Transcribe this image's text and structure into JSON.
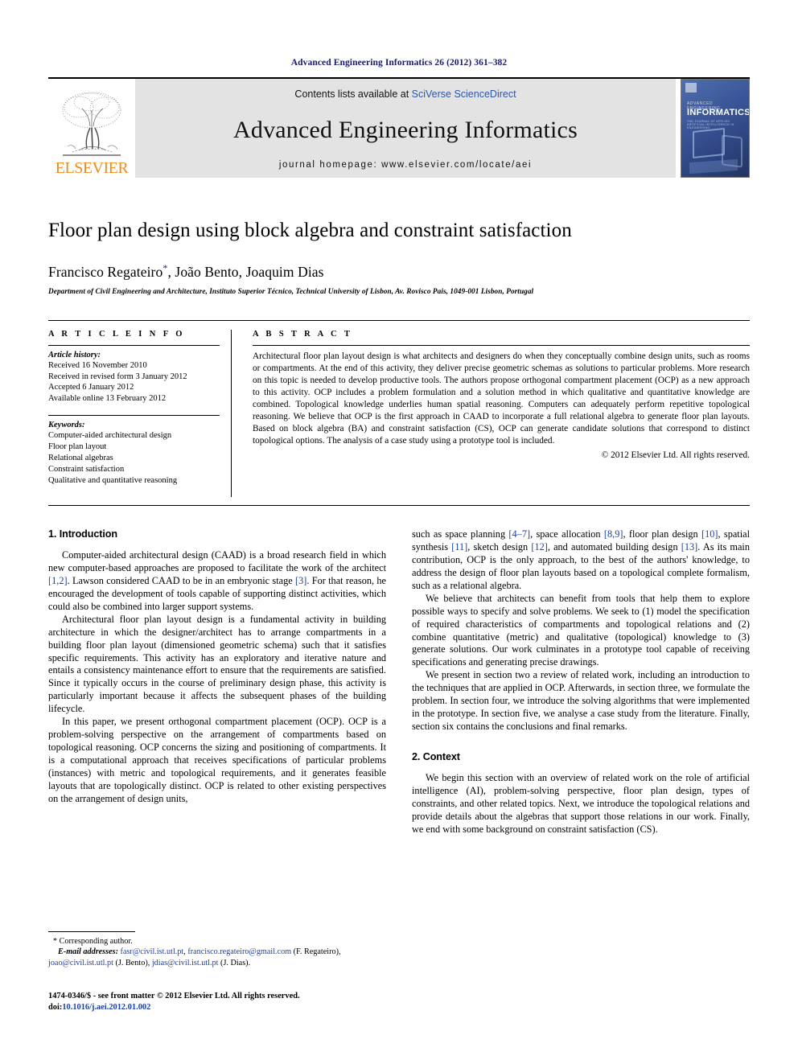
{
  "running_head": "Advanced Engineering Informatics 26 (2012) 361–382",
  "masthead": {
    "publisher_name": "ELSEVIER",
    "contents_prefix": "Contents lists available at ",
    "contents_link": "SciVerse ScienceDirect",
    "journal_title": "Advanced Engineering Informatics",
    "homepage_line": "journal homepage: www.elsevier.com/locate/aei",
    "cover": {
      "supertitle": "ADVANCED ENGINEERING",
      "title": "INFORMATICS",
      "subtitle": "THE JOURNAL OF APPLIED ARTIFICIAL INTELLIGENCE IN ENGINEERING"
    }
  },
  "article": {
    "title": "Floor plan design using block algebra and constraint satisfaction",
    "authors": "Francisco Regateiro",
    "corresponding_marker": "*",
    "authors_rest": ", João Bento, Joaquim Dias",
    "affiliation": "Department of Civil Engineering and Architecture, Instituto Superior Técnico, Technical University of Lisbon, Av. Rovisco Pais, 1049-001 Lisbon, Portugal"
  },
  "article_info": {
    "heading": "A R T I C L E   I N F O",
    "history_label": "Article history:",
    "history": [
      "Received 16 November 2010",
      "Received in revised form 3 January 2012",
      "Accepted 6 January 2012",
      "Available online 13 February 2012"
    ],
    "keywords_label": "Keywords:",
    "keywords": [
      "Computer-aided architectural design",
      "Floor plan layout",
      "Relational algebras",
      "Constraint satisfaction",
      "Qualitative and quantitative reasoning"
    ]
  },
  "abstract": {
    "heading": "A B S T R A C T",
    "text": "Architectural floor plan layout design is what architects and designers do when they conceptually combine design units, such as rooms or compartments. At the end of this activity, they deliver precise geometric schemas as solutions to particular problems. More research on this topic is needed to develop productive tools. The authors propose orthogonal compartment placement (OCP) as a new approach to this activity. OCP includes a problem formulation and a solution method in which qualitative and quantitative knowledge are combined. Topological knowledge underlies human spatial reasoning. Computers can adequately perform repetitive topological reasoning. We believe that OCP is the first approach in CAAD to incorporate a full relational algebra to generate floor plan layouts. Based on block algebra (BA) and constraint satisfaction (CS), OCP can generate candidate solutions that correspond to distinct topological options. The analysis of a case study using a prototype tool is included.",
    "copyright": "© 2012 Elsevier Ltd. All rights reserved."
  },
  "sections": {
    "introduction_heading": "1. Introduction",
    "context_heading": "2. Context"
  },
  "left_column": {
    "p1_a": "Computer-aided architectural design (CAAD) is a broad research field in which new computer-based approaches are proposed to facilitate the work of the architect ",
    "p1_ref1": "[1,2]",
    "p1_b": ". Lawson considered CAAD to be in an embryonic stage ",
    "p1_ref2": "[3]",
    "p1_c": ". For that reason, he encouraged the development of tools capable of supporting distinct activities, which could also be combined into larger support systems.",
    "p2": "Architectural floor plan layout design is a fundamental activity in building architecture in which the designer/architect has to arrange compartments in a building floor plan layout (dimensioned geometric schema) such that it satisfies specific requirements. This activity has an exploratory and iterative nature and entails a consistency maintenance effort to ensure that the requirements are satisfied. Since it typically occurs in the course of preliminary design phase, this activity is particularly important because it affects the subsequent phases of the building lifecycle.",
    "p3": "In this paper, we present orthogonal compartment placement (OCP). OCP is a problem-solving perspective on the arrangement of compartments based on topological reasoning. OCP concerns the sizing and positioning of compartments. It is a computational approach that receives specifications of particular problems (instances) with metric and topological requirements, and it generates feasible layouts that are topologically distinct. OCP is related to other existing perspectives on the arrangement of design units,"
  },
  "right_column": {
    "p1_a": "such as space planning ",
    "p1_ref1": "[4–7]",
    "p1_b": ", space allocation ",
    "p1_ref2": "[8,9]",
    "p1_c": ", floor plan design ",
    "p1_ref3": "[10]",
    "p1_d": ", spatial synthesis ",
    "p1_ref4": "[11]",
    "p1_e": ", sketch design ",
    "p1_ref5": "[12]",
    "p1_f": ", and automated building design ",
    "p1_ref6": "[13]",
    "p1_g": ". As its main contribution, OCP is the only approach, to the best of the authors' knowledge, to address the design of floor plan layouts based on a topological complete formalism, such as a relational algebra.",
    "p2": "We believe that architects can benefit from tools that help them to explore possible ways to specify and solve problems. We seek to (1) model the specification of required characteristics of compartments and topological relations and (2) combine quantitative (metric) and qualitative (topological) knowledge to (3) generate solutions. Our work culminates in a prototype tool capable of receiving specifications and generating precise drawings.",
    "p3": "We present in section two a review of related work, including an introduction to the techniques that are applied in OCP. Afterwards, in section three, we formulate the problem. In section four, we introduce the solving algorithms that were implemented in the prototype. In section five, we analyse a case study from the literature. Finally, section six contains the conclusions and final remarks.",
    "p4": "We begin this section with an overview of related work on the role of artificial intelligence (AI), problem-solving perspective, floor plan design, types of constraints, and other related topics. Next, we introduce the topological relations and provide details about the algebras that support those relations in our work. Finally, we end with some background on constraint satisfaction (CS)."
  },
  "footnote": {
    "corresponding": "* Corresponding author.",
    "email_label": "E-mail addresses:",
    "email1": "fasr@civil.ist.utl.pt",
    "sep1": ", ",
    "email2": "francisco.regateiro@gmail.com",
    "name1": " (F. Regateiro), ",
    "email3": "joao@civil.ist.utl.pt",
    "name2": " (J. Bento), ",
    "email4": "jdias@civil.ist.utl.pt",
    "name3": " (J. Dias)."
  },
  "footer": {
    "issn_line": "1474-0346/$ - see front matter © 2012 Elsevier Ltd. All rights reserved.",
    "doi_label": "doi:",
    "doi_value": "10.1016/j.aei.2012.01.002"
  },
  "colors": {
    "running_head": "#1a1a6e",
    "link": "#1a3faa",
    "sciencedirect": "#2b57a8",
    "elsevier_orange": "#F08C1E",
    "masthead_bg": "#e3e3e3"
  }
}
